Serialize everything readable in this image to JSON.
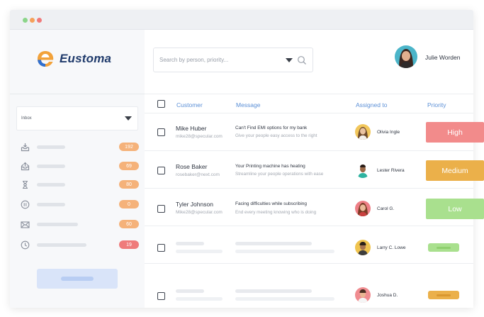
{
  "app": {
    "brand": "Eustoma",
    "window_dots": [
      "#8bd58a",
      "#f5a05a",
      "#f07a7a"
    ]
  },
  "sidebar": {
    "inbox_label": "Inbox",
    "items": [
      {
        "icon": "inbox-download-icon",
        "count": "192",
        "color": "#f5b27a"
      },
      {
        "icon": "inbox-upload-icon",
        "count": "69",
        "color": "#f5b27a"
      },
      {
        "icon": "hourglass-icon",
        "count": "80",
        "color": "#f5b27a"
      },
      {
        "icon": "pause-circle-icon",
        "count": "0",
        "color": "#f5b27a"
      },
      {
        "icon": "mail-icon",
        "count": "60",
        "color": "#f5b27a"
      },
      {
        "icon": "clock-icon",
        "count": "19",
        "color": "#ef7b7b"
      }
    ]
  },
  "search": {
    "placeholder": "Search by person, priority..."
  },
  "user": {
    "name": "Julie Worden"
  },
  "table": {
    "headers": {
      "customer": "Customer",
      "message": "Message",
      "assigned": "Assigned to",
      "priority": "Priority"
    },
    "rows": [
      {
        "name": "Mike Huber",
        "email": "mike28@specular.com",
        "msg_title": "Can't Find EMI options for my bank",
        "msg_sub": "Give your people easy access to the right",
        "assignee": "Olivia Ingle",
        "priority": "High",
        "priority_color": "#f28b8b"
      },
      {
        "name": "Rose Baker",
        "email": "rosebaker@next.com",
        "msg_title": "Your Printing machine has heating",
        "msg_sub": "Streamline your people operations with ease",
        "assignee": "Lester Rivera",
        "priority": "Medium",
        "priority_color": "#ebb04a"
      },
      {
        "name": "Tyler Johnson",
        "email": "Mike28@specular.com",
        "msg_title": "Facing difficulties while subscribing",
        "msg_sub": "End every meeting knowing who is doing",
        "assignee": "Carol G.",
        "priority": "Low",
        "priority_color": "#a9e08e"
      },
      {
        "assignee": "Larry C. Lowe",
        "pill_color": "#a9e08e",
        "pill_inner": "#8fd06f"
      },
      {
        "assignee": "Joshua D.",
        "pill_color": "#ebb04a",
        "pill_inner": "#d9972f"
      }
    ]
  }
}
